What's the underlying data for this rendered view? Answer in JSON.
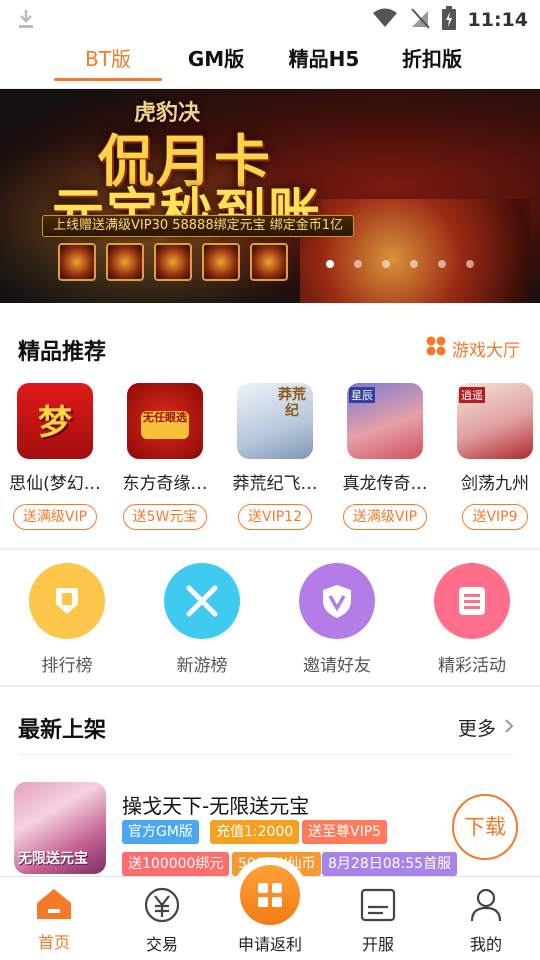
{
  "status_bar": {
    "time": "11:14"
  },
  "tabs": [
    {
      "label": "BT版",
      "active": true
    },
    {
      "label": "GM版",
      "active": false
    },
    {
      "label": "精品H5",
      "active": false
    },
    {
      "label": "折扣版",
      "active": false
    }
  ],
  "banner": {
    "small_text": "虎豹决",
    "headline_1": "侃月卡",
    "headline_2": "元宝秒到账",
    "strip": "上线赠送满级VIP30  58888绑定元宝  绑定金币1亿",
    "dots": 3,
    "active_dot": 1
  },
  "featured": {
    "title": "精品推荐",
    "hall_link": "游戏大厅",
    "games": [
      {
        "name": "思仙(梦幻…",
        "tag": "送满级VIP",
        "icon_text": "梦",
        "icon_bg": "#c8141a"
      },
      {
        "name": "东方奇缘…",
        "tag": "送5W元宝",
        "icon_text": "无任眼选",
        "icon_bg": "#b3120e"
      },
      {
        "name": "莽荒纪飞…",
        "tag": "送VIP12",
        "icon_text": "莽荒纪",
        "icon_bg": "#cfd8e4"
      },
      {
        "name": "真龙传奇…",
        "tag": "送满级VIP",
        "icon_text": "星辰",
        "icon_bg": "#5a5aa8"
      },
      {
        "name": "剑荡九州",
        "tag": "送VIP9",
        "icon_text": "逍遥",
        "icon_bg": "#e9c8b6"
      }
    ]
  },
  "quick_entries": [
    {
      "label": "排行榜",
      "color": "#fcc64a"
    },
    {
      "label": "新游榜",
      "color": "#3fcaf0"
    },
    {
      "label": "邀请好友",
      "color": "#b47ce6"
    },
    {
      "label": "精彩活动",
      "color": "#ff6f8c"
    }
  ],
  "new_games": {
    "title": "最新上架",
    "more_label": "更多",
    "items": [
      {
        "title": "操戈天下-无限送元宝",
        "icon_text": "无限送元宝",
        "tags": [
          {
            "text": "官方GM版",
            "color": "#4aa7f0"
          },
          {
            "text": "充值1:2000",
            "color": "#f5a01e"
          },
          {
            "text": "送至尊VIP5",
            "color": "#ff7a5a"
          },
          {
            "text": "送100000绑元",
            "color": "#ff6e6e"
          },
          {
            "text": "5000W仙币",
            "color": "#f59a32"
          },
          {
            "text": "8月28日08:55首服",
            "color": "#a884e8"
          }
        ],
        "download_label": "下载"
      }
    ]
  },
  "bottom_nav": [
    {
      "label": "首页",
      "active": true
    },
    {
      "label": "交易",
      "active": false
    },
    {
      "label": "申请返利",
      "active": false
    },
    {
      "label": "开服",
      "active": false
    },
    {
      "label": "我的",
      "active": false
    }
  ],
  "colors": {
    "accent": "#f47a2a"
  }
}
